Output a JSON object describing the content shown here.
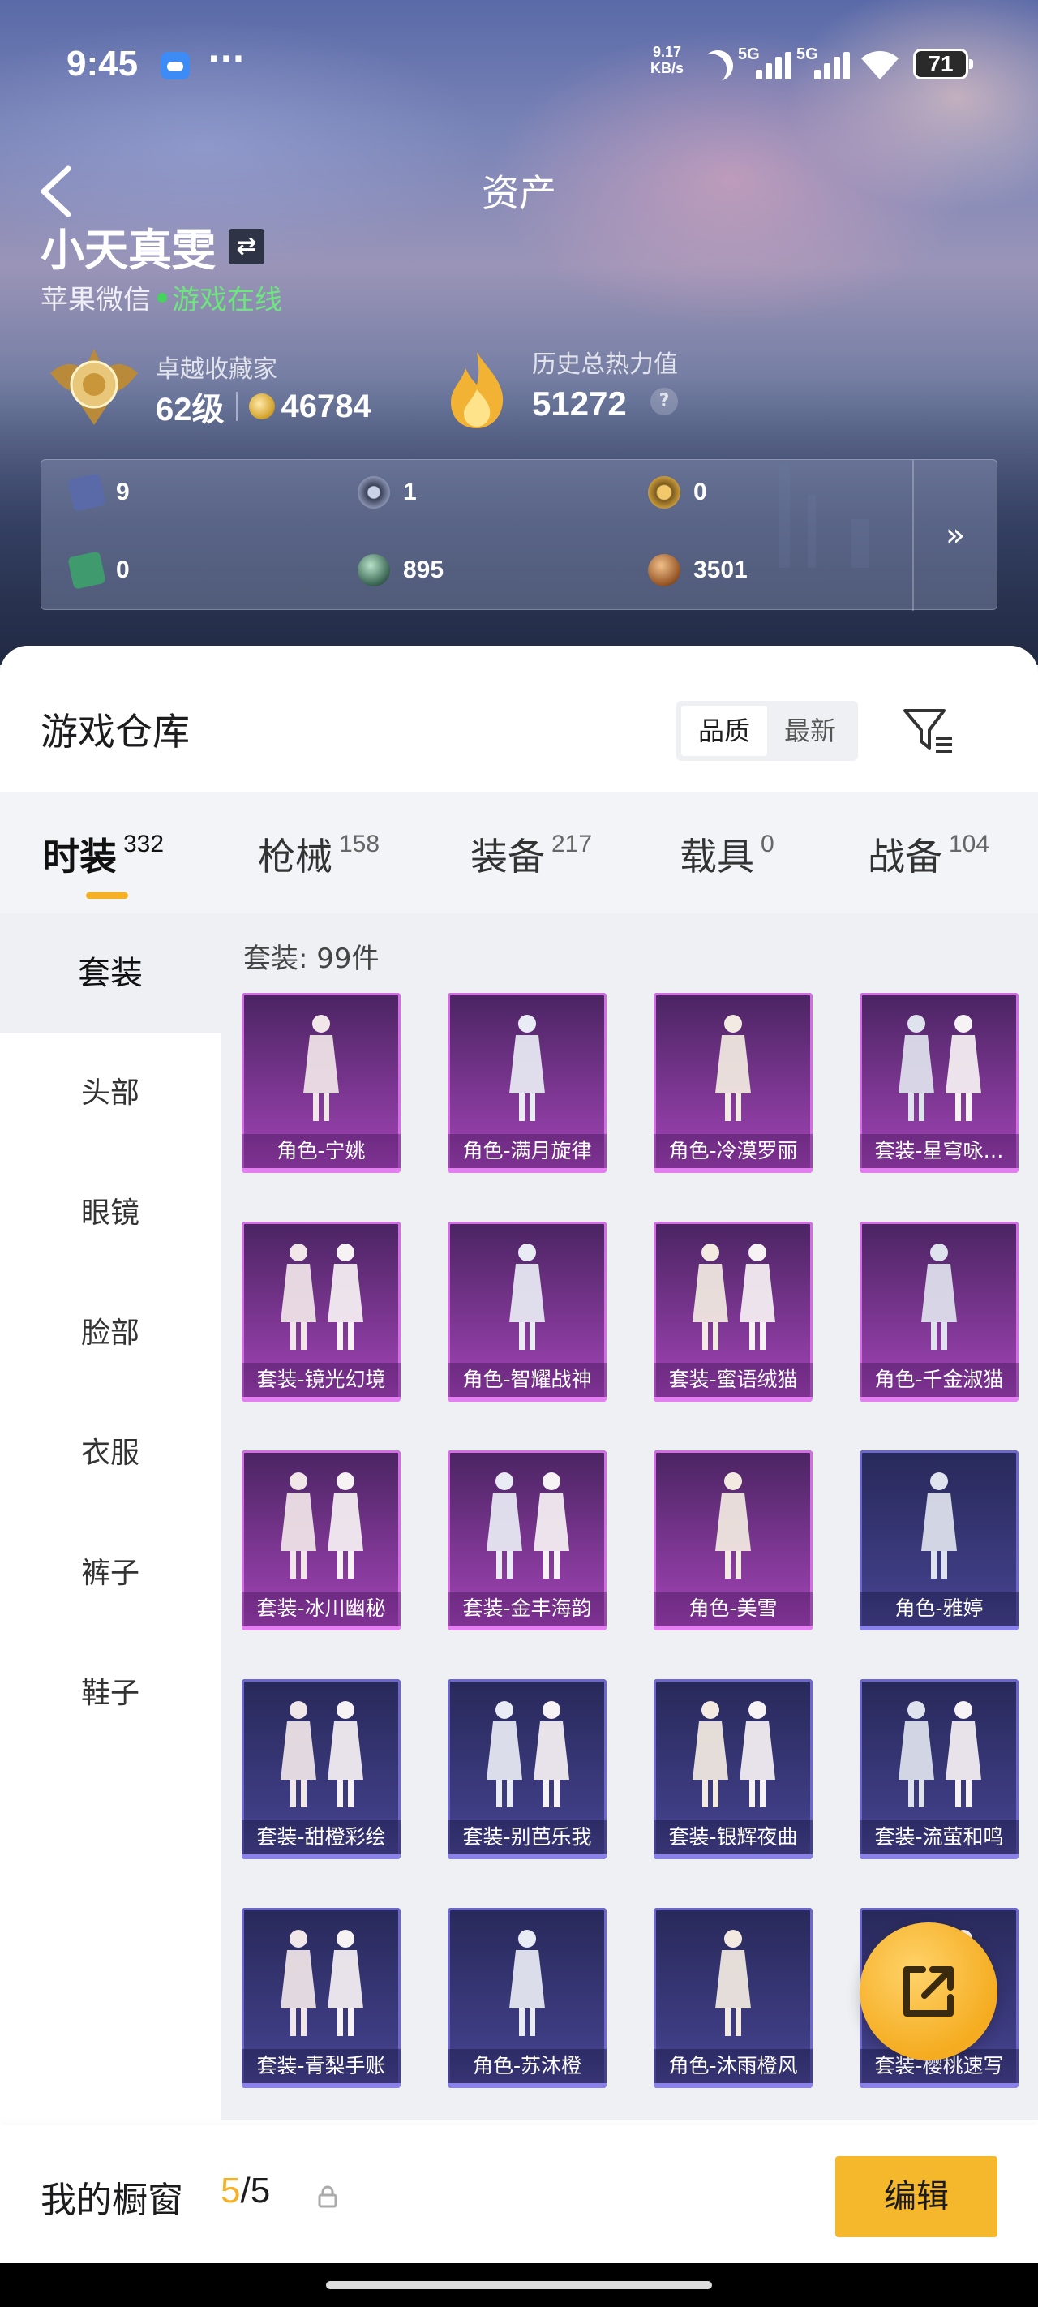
{
  "status_bar": {
    "time": "9:45",
    "dots": "···",
    "speed_value": "9.17",
    "speed_unit": "KB/s",
    "net1": "5G",
    "net2": "5G",
    "battery": "71"
  },
  "header": {
    "title": "资产",
    "user_name": "小天真雯",
    "swap_icon": "⇄",
    "platform": "苹果微信",
    "online_status": "游戏在线"
  },
  "collector": {
    "title": "卓越收藏家",
    "level": "62级",
    "coins": "46784"
  },
  "heat": {
    "title": "历史总热力值",
    "value": "51272",
    "help_icon": "?"
  },
  "stats": [
    {
      "icon": "card-icon",
      "value": "9"
    },
    {
      "icon": "token-icon",
      "value": "1"
    },
    {
      "icon": "gold-medal-icon",
      "value": "0"
    },
    {
      "icon": "green-card-icon",
      "value": "0"
    },
    {
      "icon": "orb-icon",
      "value": "895"
    },
    {
      "icon": "bronze-coin-icon",
      "value": "3501"
    }
  ],
  "stats_more": "»",
  "warehouse": {
    "title": "游戏仓库",
    "sort_options": [
      "品质",
      "最新"
    ],
    "active_sort": "品质"
  },
  "tabs": [
    {
      "label": "时装",
      "count": "332"
    },
    {
      "label": "枪械",
      "count": "158"
    },
    {
      "label": "装备",
      "count": "217"
    },
    {
      "label": "载具",
      "count": "0"
    },
    {
      "label": "战备",
      "count": "104"
    }
  ],
  "sidebar": [
    "套装",
    "头部",
    "眼镜",
    "脸部",
    "衣服",
    "裤子",
    "鞋子"
  ],
  "content": {
    "count_label": "套装: 99件"
  },
  "items": [
    {
      "label": "角色-宁姚",
      "tier": "purple"
    },
    {
      "label": "角色-满月旋律",
      "tier": "purple"
    },
    {
      "label": "角色-冷漠罗丽",
      "tier": "purple"
    },
    {
      "label": "套装-星穹咏…",
      "tier": "purple"
    },
    {
      "label": "套装-镜光幻境",
      "tier": "purple"
    },
    {
      "label": "角色-智耀战神",
      "tier": "purple"
    },
    {
      "label": "套装-蜜语绒猫",
      "tier": "purple"
    },
    {
      "label": "角色-千金淑猫",
      "tier": "purple"
    },
    {
      "label": "套装-冰川幽秘",
      "tier": "purple"
    },
    {
      "label": "套装-金丰海韵",
      "tier": "purple"
    },
    {
      "label": "角色-美雪",
      "tier": "purple"
    },
    {
      "label": "角色-雅婷",
      "tier": "blue"
    },
    {
      "label": "套装-甜橙彩绘",
      "tier": "blue"
    },
    {
      "label": "套装-别芭乐我",
      "tier": "blue"
    },
    {
      "label": "套装-银辉夜曲",
      "tier": "blue"
    },
    {
      "label": "套装-流萤和鸣",
      "tier": "blue"
    },
    {
      "label": "套装-青梨手账",
      "tier": "blue"
    },
    {
      "label": "角色-苏沐橙",
      "tier": "blue"
    },
    {
      "label": "角色-沐雨橙风",
      "tier": "blue"
    },
    {
      "label": "套装-樱桃速写",
      "tier": "blue"
    }
  ],
  "footer": {
    "title": "我的橱窗",
    "current": "5",
    "total": "/5",
    "edit_label": "编辑"
  },
  "colors": {
    "accent": "#f5b025",
    "online": "#44d35c",
    "purple_tier": "#8e3da3",
    "blue_tier": "#3f3d84"
  }
}
